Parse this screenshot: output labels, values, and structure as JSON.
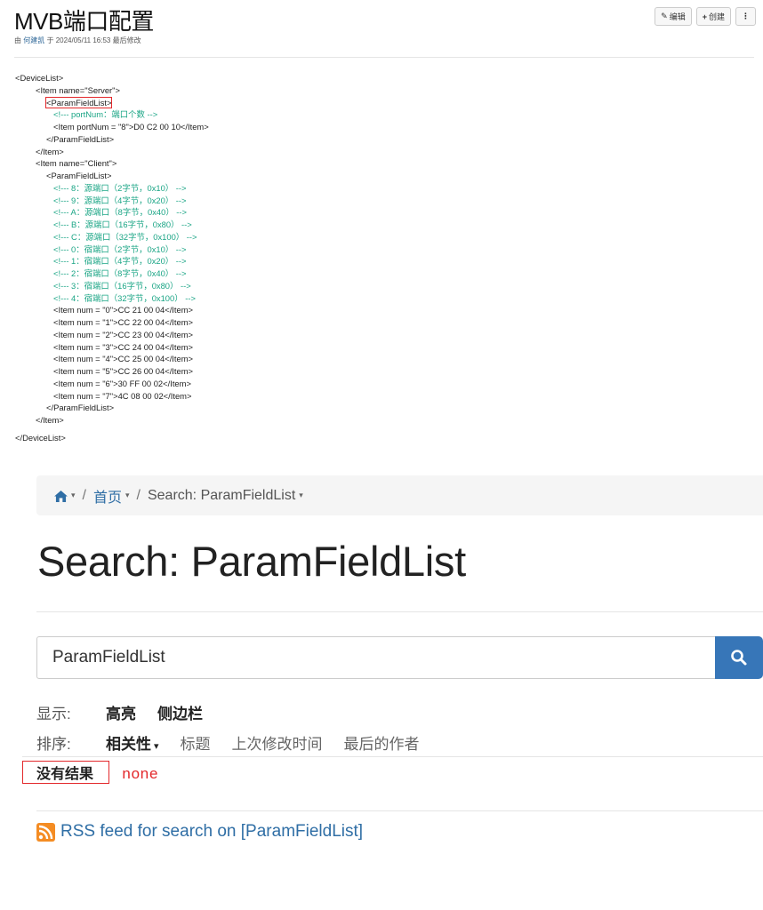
{
  "page": {
    "title": "MVB端口配置",
    "meta_prefix": "由",
    "author": "何建凯",
    "meta_suffix": "于 2024/05/11 16:53 最后修改"
  },
  "toolbar": {
    "edit_label": "编辑",
    "create_label": "创建",
    "more_label": "⋮"
  },
  "code_lines": [
    {
      "text": "<DeviceList>",
      "indent": 0,
      "type": "tag"
    },
    {
      "text": "<Item name=\"Server\">",
      "indent": 1,
      "type": "tag"
    },
    {
      "text": "<ParamFieldList>",
      "indent": 2,
      "type": "tag",
      "highlight": true
    },
    {
      "text": "<!--- portNum：端口个数 -->",
      "indent": 3,
      "type": "comment"
    },
    {
      "text": "<Item portNum = \"8\">D0 C2 00 10</Item>",
      "indent": 3,
      "type": "tag"
    },
    {
      "text": "</ParamFieldList>",
      "indent": 2,
      "type": "tag"
    },
    {
      "text": "</Item>",
      "indent": 1,
      "type": "tag"
    },
    {
      "text": "<Item name=\"Client\">",
      "indent": 1,
      "type": "tag"
    },
    {
      "text": "<ParamFieldList>",
      "indent": 2,
      "type": "tag"
    },
    {
      "text": "<!--- 8：源端口（2字节，0x10） -->",
      "indent": 3,
      "type": "comment"
    },
    {
      "text": "<!--- 9：源端口（4字节，0x20） -->",
      "indent": 3,
      "type": "comment"
    },
    {
      "text": "<!--- A：源端口（8字节，0x40） -->",
      "indent": 3,
      "type": "comment"
    },
    {
      "text": "<!--- B：源端口（16字节，0x80） -->",
      "indent": 3,
      "type": "comment"
    },
    {
      "text": "<!--- C：源端口（32字节，0x100） -->",
      "indent": 3,
      "type": "comment"
    },
    {
      "text": "<!--- 0：宿端口（2字节，0x10） -->",
      "indent": 3,
      "type": "comment"
    },
    {
      "text": "<!--- 1：宿端口（4字节，0x20） -->",
      "indent": 3,
      "type": "comment"
    },
    {
      "text": "<!--- 2：宿端口（8字节，0x40） -->",
      "indent": 3,
      "type": "comment"
    },
    {
      "text": "<!--- 3：宿端口（16字节，0x80） -->",
      "indent": 3,
      "type": "comment"
    },
    {
      "text": "<!--- 4：宿端口（32字节，0x100） -->",
      "indent": 3,
      "type": "comment"
    },
    {
      "text": "<Item num = \"0\">CC 21 00 04</Item>",
      "indent": 3,
      "type": "tag"
    },
    {
      "text": "<Item num = \"1\">CC 22 00 04</Item>",
      "indent": 3,
      "type": "tag"
    },
    {
      "text": "<Item num = \"2\">CC 23 00 04</Item>",
      "indent": 3,
      "type": "tag"
    },
    {
      "text": "<Item num = \"3\">CC 24 00 04</Item>",
      "indent": 3,
      "type": "tag"
    },
    {
      "text": "<Item num = \"4\">CC 25 00 04</Item>",
      "indent": 3,
      "type": "tag"
    },
    {
      "text": "<Item num = \"5\">CC 26 00 04</Item>",
      "indent": 3,
      "type": "tag"
    },
    {
      "text": "<Item num = \"6\">30 FF 00 02</Item>",
      "indent": 3,
      "type": "tag"
    },
    {
      "text": "<Item num = \"7\">4C 08 00 02</Item>",
      "indent": 3,
      "type": "tag"
    },
    {
      "text": "</ParamFieldList>",
      "indent": 2,
      "type": "tag"
    },
    {
      "text": "</Item>",
      "indent": 1,
      "type": "tag"
    },
    {
      "text": "</DeviceList>",
      "indent": 0,
      "type": "tag",
      "gap_before": true
    }
  ],
  "breadcrumb": {
    "home_caret": "▾",
    "sep1": "/",
    "item1": "首页",
    "item1_caret": "▾",
    "sep2": "/",
    "item2": "Search: ParamFieldList",
    "item2_caret": "▾"
  },
  "search": {
    "heading": "Search: ParamFieldList",
    "query": "ParamFieldList"
  },
  "display_options": {
    "label": "显示:",
    "items": [
      "高亮",
      "侧边栏"
    ]
  },
  "sort_options": {
    "label": "排序:",
    "active": "相关性",
    "active_caret": "▾",
    "items": [
      "标题",
      "上次修改时间",
      "最后的作者"
    ]
  },
  "results": {
    "no_results": "没有结果",
    "annotation": "none"
  },
  "rss": {
    "label": "RSS feed for search on [ParamFieldList]"
  },
  "colors": {
    "link": "#2f6ea5",
    "comment": "#1aa585",
    "annotation_red": "#e3282b",
    "search_button": "#3776b8"
  }
}
